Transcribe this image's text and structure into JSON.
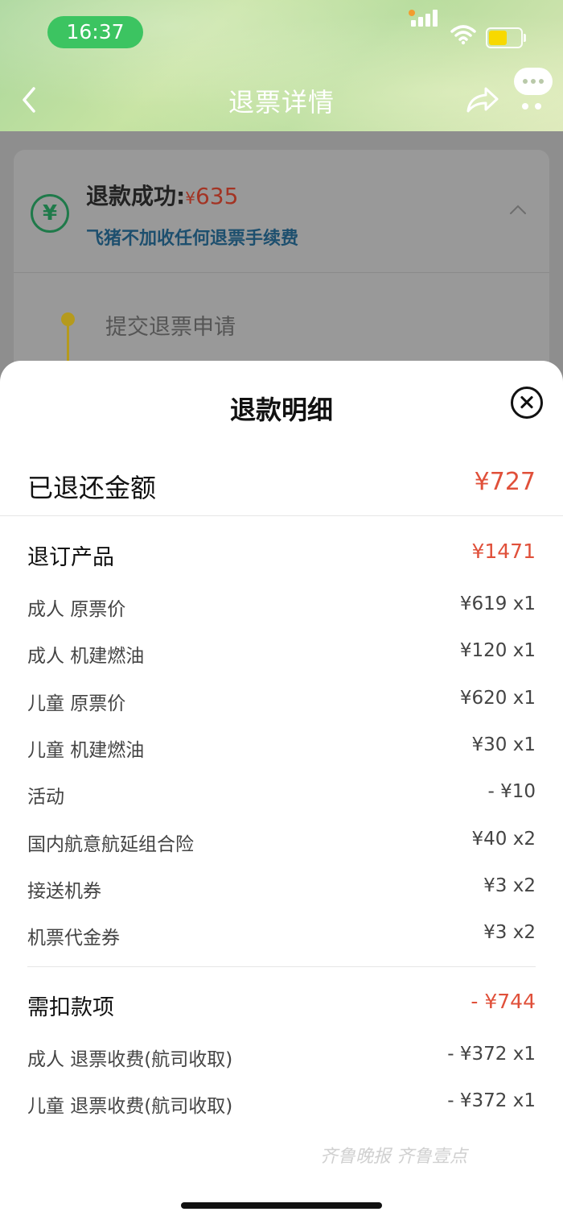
{
  "status_bar": {
    "time": "16:37",
    "colors": {
      "pill": "#3cc461",
      "battery": "#f7d900"
    }
  },
  "header": {
    "title": "退票详情",
    "icons": [
      "back-arrow-icon",
      "share-icon",
      "more-icon"
    ]
  },
  "refund_card": {
    "status_label": "退款成功:",
    "currency": "¥",
    "amount": "635",
    "note": "飞猪不加收任何退票手续费",
    "icon": "yen-circle-icon"
  },
  "timeline": {
    "steps": [
      {
        "label": "提交退票申请"
      }
    ]
  },
  "sheet": {
    "title": "退款明细",
    "refunded": {
      "label": "已退还金额",
      "amount": "¥727"
    },
    "products": {
      "label": "退订产品",
      "amount": "¥1471",
      "items": [
        {
          "label": "成人 原票价",
          "value": "¥619 x1"
        },
        {
          "label": "成人 机建燃油",
          "value": "¥120 x1"
        },
        {
          "label": "儿童 原票价",
          "value": "¥620 x1"
        },
        {
          "label": "儿童 机建燃油",
          "value": "¥30 x1"
        },
        {
          "label": "活动",
          "value": "- ¥10"
        },
        {
          "label": "国内航意航延组合险",
          "value": "¥40 x2"
        },
        {
          "label": "接送机券",
          "value": "¥3 x2"
        },
        {
          "label": "机票代金券",
          "value": "¥3 x2"
        }
      ]
    },
    "deductions": {
      "label": "需扣款项",
      "amount": "- ¥744",
      "items": [
        {
          "label": "成人 退票收费(航司收取)",
          "value": "- ¥372 x1"
        },
        {
          "label": "儿童 退票收费(航司收取)",
          "value": "- ¥372 x1"
        }
      ]
    }
  },
  "watermark": "齐鲁晚报 齐鲁壹点",
  "accent_color": "#e0503a"
}
